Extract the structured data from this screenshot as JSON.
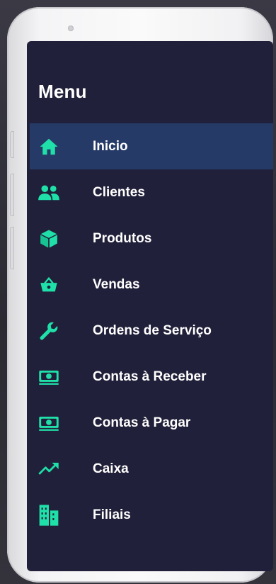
{
  "menu": {
    "title": "Menu",
    "active_index": 0,
    "items": [
      {
        "label": "Inicio",
        "icon": "home-icon"
      },
      {
        "label": "Clientes",
        "icon": "users-icon"
      },
      {
        "label": "Produtos",
        "icon": "box-icon"
      },
      {
        "label": "Vendas",
        "icon": "basket-icon"
      },
      {
        "label": "Ordens de Serviço",
        "icon": "wrench-icon"
      },
      {
        "label": "Contas à Receber",
        "icon": "money-icon"
      },
      {
        "label": "Contas à Pagar",
        "icon": "money-icon"
      },
      {
        "label": "Caixa",
        "icon": "trending-up-icon"
      },
      {
        "label": "Filiais",
        "icon": "buildings-icon"
      }
    ]
  },
  "colors": {
    "screen_background": "#21203a",
    "active_item_background": "#263a68",
    "icon_accent": "#1fe0a8",
    "text": "#ffffff"
  }
}
